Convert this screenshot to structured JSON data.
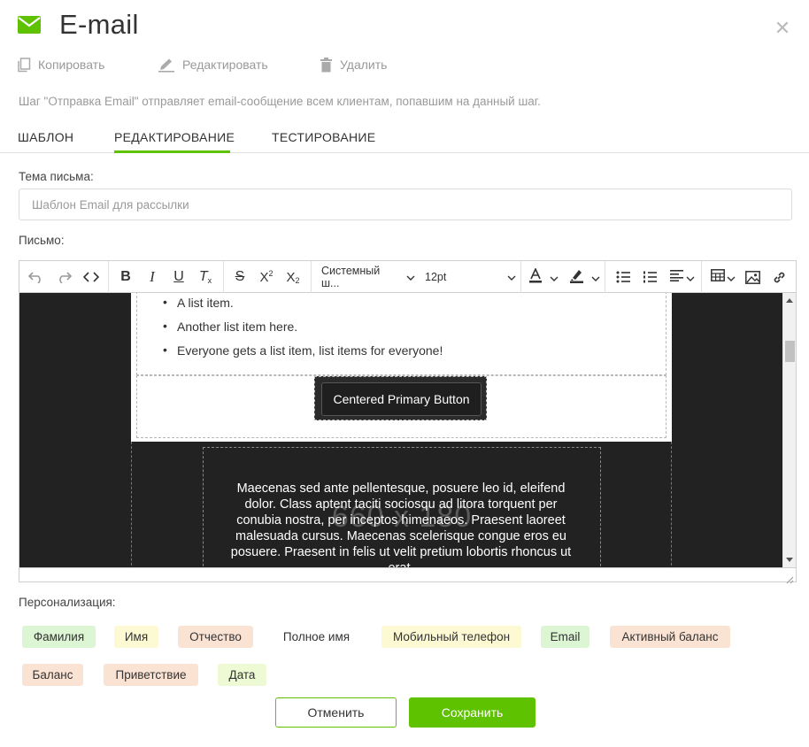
{
  "header": {
    "title": "E-mail",
    "icon": "envelope-icon",
    "accent_color": "#5ec200"
  },
  "actions": {
    "copy": "Копировать",
    "edit": "Редактировать",
    "delete": "Удалить"
  },
  "description": "Шаг \"Отправка Email\" отправляет email-сообщение всем клиентам, попавшим на данный шаг.",
  "tabs": [
    {
      "label": "ШАБЛОН",
      "active": false
    },
    {
      "label": "РЕДАКТИРОВАНИЕ",
      "active": true
    },
    {
      "label": "ТЕСТИРОВАНИЕ",
      "active": false
    }
  ],
  "subject": {
    "label": "Тема письма:",
    "placeholder": "Шаблон Email для рассылки",
    "value": ""
  },
  "letter": {
    "label": "Письмо:"
  },
  "toolbar": {
    "font_family": "Системный ш...",
    "font_size": "12pt"
  },
  "content": {
    "list_items": [
      "A list item.",
      "Another list item here.",
      "Everyone gets a list item, list items for everyone!"
    ],
    "primary_button": "Centered Primary Button",
    "image_placeholder": "660 x 180",
    "body_text": "Maecenas sed ante pellentesque, posuere leo id, eleifend dolor. Class aptent taciti sociosqu ad litora torquent per conubia nostra, per inceptos himenaeos. Praesent laoreet malesuada cursus. Maecenas scelerisque congue eros eu posuere. Praesent in felis ut velit pretium lobortis rhoncus ut erat."
  },
  "personalization": {
    "label": "Персонализация:",
    "tags": [
      {
        "label": "Фамилия",
        "color": "#dcf5d3"
      },
      {
        "label": "Имя",
        "color": "#fdf9d3"
      },
      {
        "label": "Отчество",
        "color": "#fbe3d4"
      },
      {
        "label": "Полное имя",
        "color": "#ffffff"
      },
      {
        "label": "Мобильный телефон",
        "color": "#fdf9d3"
      },
      {
        "label": "Email",
        "color": "#dcf5d3"
      },
      {
        "label": "Активный баланс",
        "color": "#fbe3d4"
      },
      {
        "label": "Баланс",
        "color": "#fbe3d4"
      },
      {
        "label": "Приветствие",
        "color": "#fbe3d4"
      },
      {
        "label": "Дата",
        "color": "#eefad3"
      }
    ]
  },
  "footer": {
    "cancel": "Отменить",
    "save": "Сохранить"
  }
}
